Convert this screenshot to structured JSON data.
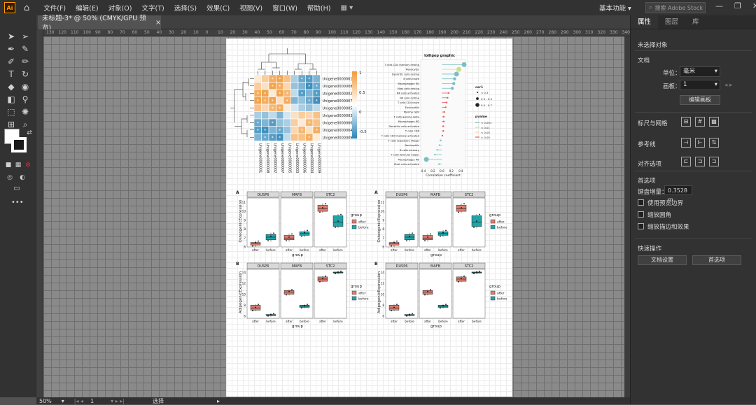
{
  "app": {
    "logo": "Ai",
    "home_icon": "home-icon"
  },
  "menu": [
    "文件(F)",
    "编辑(E)",
    "对象(O)",
    "文字(T)",
    "选择(S)",
    "效果(C)",
    "视图(V)",
    "窗口(W)",
    "帮助(H)"
  ],
  "workspace": "基本功能",
  "stock_search": {
    "placeholder": "搜索 Adobe Stock"
  },
  "doc_tab": {
    "title": "未标题-3* @ 50% (CMYK/GPU 预览)",
    "close": "×"
  },
  "ruler_numbers": [
    "130",
    "120",
    "110",
    "100",
    "90",
    "80",
    "70",
    "60",
    "50",
    "40",
    "30",
    "20",
    "10",
    "0",
    "10",
    "20",
    "30",
    "40",
    "50",
    "60",
    "70",
    "80",
    "90",
    "100",
    "110",
    "120",
    "130",
    "140",
    "150",
    "160",
    "170",
    "180",
    "190",
    "200",
    "210",
    "220",
    "230",
    "240",
    "250",
    "260",
    "270",
    "280",
    "290",
    "300",
    "310",
    "320",
    "330",
    "340"
  ],
  "status": {
    "zoom": "50%",
    "artboard_num": "1",
    "tool": "选择"
  },
  "panel": {
    "tabs": [
      "属性",
      "图层",
      "库"
    ],
    "no_selection": "未选择对象",
    "document_section": "文档",
    "units_label": "单位：",
    "units_value": "毫米",
    "artboard_label": "画板：",
    "artboard_value": "1",
    "edit_artboard_button": "编辑画板",
    "rulers_grids": "标尺与网格",
    "guides": "参考线",
    "align": "对齐选项",
    "preferences": "首选项",
    "keyboard_increment_label": "键盘增量：",
    "keyboard_increment_value": "0.3528 m",
    "checkbox_preview_bounds": "使用预览边界",
    "checkbox_scale_corners": "缩放圆角",
    "checkbox_scale_strokes": "缩放描边和效果",
    "quick_actions": "快速操作",
    "doc_setup_button": "文档设置",
    "preferences_button": "首选项"
  },
  "figure": {
    "heatmap_rows": [
      "Unigene0000001",
      "Unigene0000008",
      "Unigene0000002",
      "Unigene0000007",
      "Unigene0000005",
      "Unigene0000003",
      "Unigene0000006",
      "Unigene0000004",
      "Unigene0000009"
    ],
    "heatmap_legend": [
      "1",
      "0.5",
      "0",
      "-0.5"
    ],
    "lollipop_title": "lollipop graphic",
    "lollipop_xlabel": "Correlation coefficient",
    "lollipop_ticks": [
      "-0.4",
      "-0.2",
      "0.0",
      "0.2",
      "0.4"
    ],
    "lollipop_cells": [
      "T cells CD4 memory resting",
      "Monocytes",
      "Dendritic cells resting",
      "B cells naive",
      "Macrophages M1",
      "Mast cells resting",
      "NK cells activated",
      "NK cells resting",
      "T cells CD4 naive",
      "Eosinophils",
      "Plasma cells",
      "T cells gamma delta",
      "Macrophages M2",
      "Dendritic cells activated",
      "T cells CD8",
      "T cells CD4 memory activated",
      "T cells regulatory (Tregs)",
      "Neutrophils",
      "B cells memory",
      "T cells follicular helper",
      "Macrophages M0",
      "Mast cells activated"
    ],
    "lollipop_legend_cor_title": "cor1",
    "lollipop_legend_cor": [
      "< 0.3",
      "0.3 - 0.5",
      "0.5 - 0.7"
    ],
    "lollipop_legend_p_title": "pvalue",
    "lollipop_legend_p": [
      "< 0.001",
      "< 0.01",
      "< 0.05",
      "> 0.05"
    ],
    "box_panels": [
      {
        "tag": "A",
        "ylabel": "OsteogenicExpression",
        "yticks": [
          "11",
          "10",
          "9",
          "8",
          "7",
          "6"
        ],
        "genes": [
          "DUSP6",
          "MAFB",
          "STC2"
        ]
      },
      {
        "tag": "A",
        "ylabel": "OsteogenicExpression",
        "yticks": [
          "11",
          "10",
          "9",
          "8",
          "7",
          "6"
        ],
        "genes": [
          "DUSP6",
          "MAFB",
          "STC2"
        ]
      },
      {
        "tag": "B",
        "ylabel": "AdipogenicExpression",
        "yticks": [
          "14",
          "12",
          "10",
          "8",
          "6"
        ],
        "genes": [
          "DUSP6",
          "MAFB",
          "STC2"
        ]
      },
      {
        "tag": "B",
        "ylabel": "AdipogenicExpression",
        "yticks": [
          "14",
          "12",
          "10",
          "8",
          "6"
        ],
        "genes": [
          "DUSP6",
          "MAFB",
          "STC2"
        ]
      }
    ],
    "box_x": [
      "after",
      "before"
    ],
    "box_xlabel": "group",
    "box_legend_title": "group",
    "colors": {
      "after": "#e07b6e",
      "before": "#1fa5a8",
      "heat_pos": "#f29a3a",
      "heat_neg": "#2a84b8"
    }
  }
}
